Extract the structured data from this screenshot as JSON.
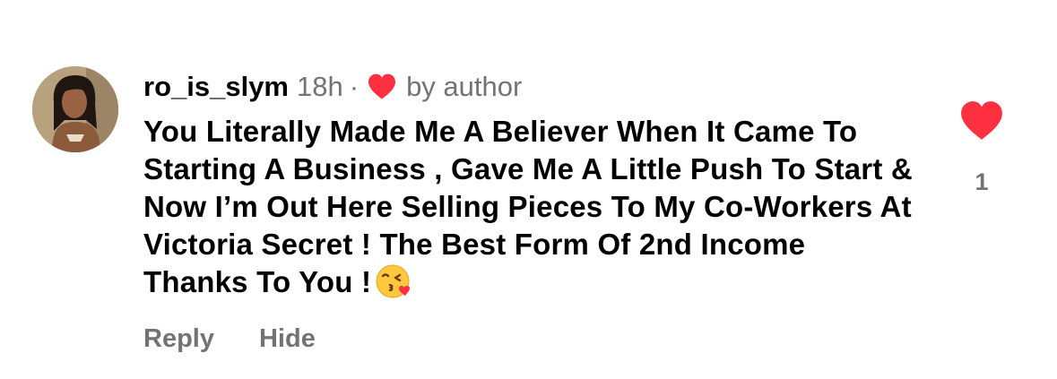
{
  "comment": {
    "username": "ro_is_slym",
    "time": "18h",
    "separator": "·",
    "liked_by_author_label": "by author",
    "text": "You Literally Made Me A Believer When It Came To Starting A Business , Gave Me A Little Push To Start & Now I’m Out Here Selling Pieces To My Co-Workers At Victoria Secret ! The Best Form Of 2nd Income Thanks To You !",
    "emoji": "face-blowing-a-kiss",
    "like_count": "1"
  },
  "actions": {
    "reply_label": "Reply",
    "hide_label": "Hide"
  },
  "icons": {
    "avatar": "user-avatar-photo",
    "author_like": "heart-icon",
    "like_button": "heart-icon"
  },
  "colors": {
    "heart": "#ff3040",
    "secondary_text": "#737373",
    "primary_text": "#000000",
    "background": "#ffffff"
  }
}
